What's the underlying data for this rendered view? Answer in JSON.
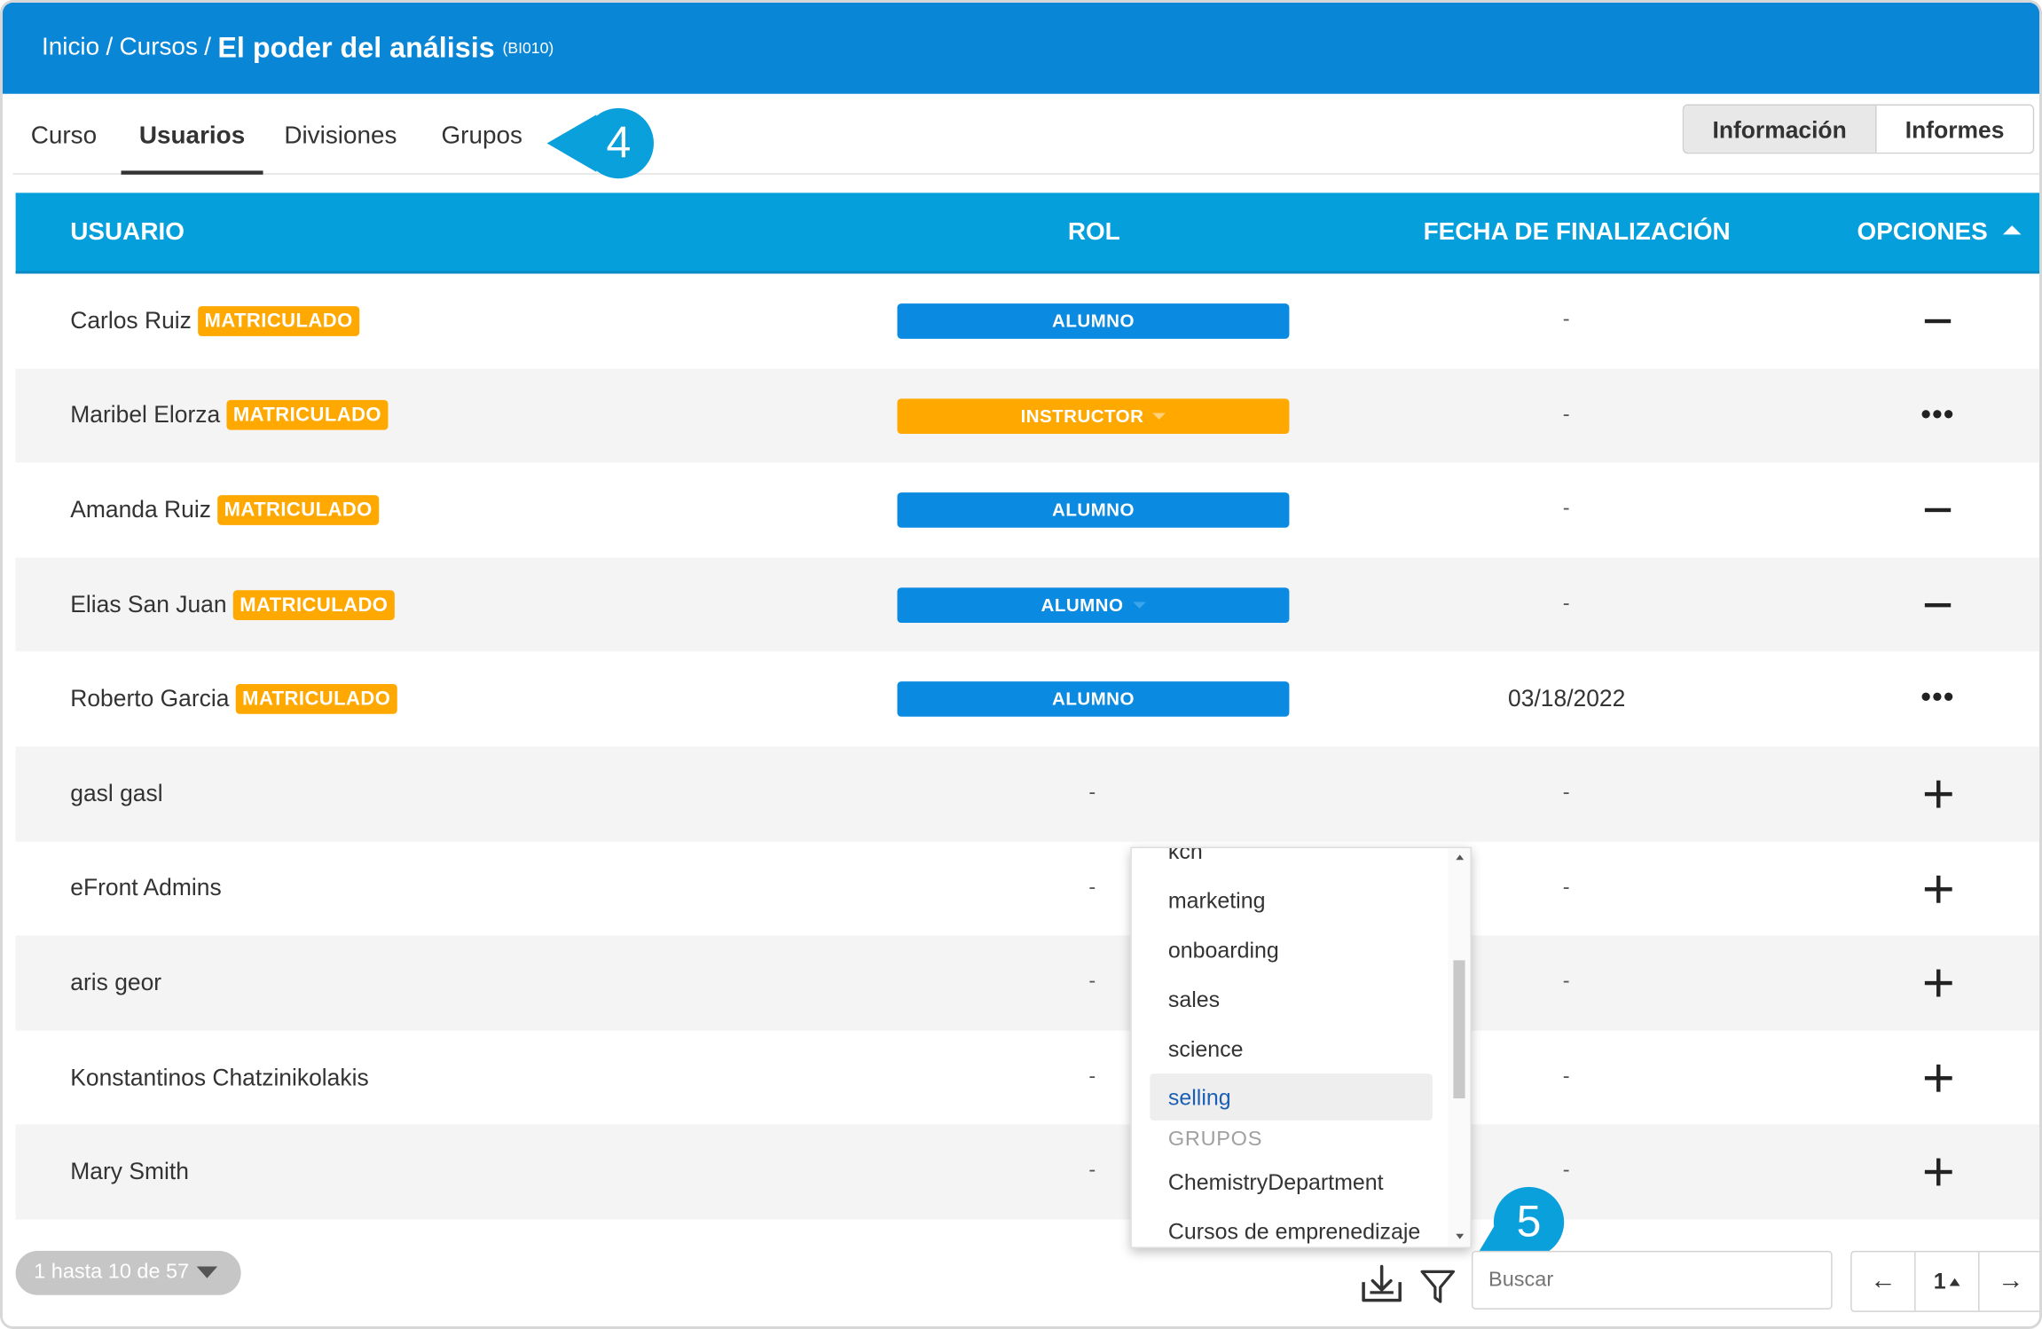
{
  "header": {
    "breadcrumb_home": "Inicio",
    "breadcrumb_sep1": "/",
    "breadcrumb_courses": "Cursos",
    "breadcrumb_sep2": "/",
    "course_title": "El poder del análisis",
    "course_code": "(BI010)"
  },
  "tabs": [
    {
      "label": "Curso"
    },
    {
      "label": "Usuarios"
    },
    {
      "label": "Divisiones"
    },
    {
      "label": "Grupos"
    }
  ],
  "markers": {
    "tab_marker": "4",
    "search_marker": "5"
  },
  "view_toggle": {
    "info": "Información",
    "reports": "Informes"
  },
  "table": {
    "columns": {
      "user": "USUARIO",
      "role": "ROL",
      "completion": "FECHA DE FINALIZACIÓN",
      "options": "OPCIONES"
    },
    "rows": [
      {
        "name": "Carlos Ruiz",
        "status": "MATRICULADO",
        "role": "ALUMNO",
        "date": "-",
        "option": "minus"
      },
      {
        "name": "Maribel Elorza",
        "status": "MATRICULADO",
        "role": "INSTRUCTOR",
        "date": "-",
        "option": "more"
      },
      {
        "name": "Amanda Ruiz",
        "status": "MATRICULADO",
        "role": "ALUMNO",
        "date": "-",
        "option": "minus"
      },
      {
        "name": "Elias San Juan",
        "status": "MATRICULADO",
        "role": "ALUMNO",
        "date": "-",
        "option": "minus"
      },
      {
        "name": "Roberto Garcia",
        "status": "MATRICULADO",
        "role": "ALUMNO",
        "date": "03/18/2022",
        "option": "more"
      },
      {
        "name": "gasl gasl",
        "status": "",
        "role": "-",
        "date": "-",
        "option": "plus"
      },
      {
        "name": "eFront Admins",
        "status": "",
        "role": "-",
        "date": "-",
        "option": "plus"
      },
      {
        "name": "aris geor",
        "status": "",
        "role": "-",
        "date": "-",
        "option": "plus"
      },
      {
        "name": "Konstantinos Chatzinikolakis",
        "status": "",
        "role": "-",
        "date": "-",
        "option": "plus"
      },
      {
        "name": "Mary Smith",
        "status": "",
        "role": "-",
        "date": "-",
        "option": "plus"
      }
    ]
  },
  "filter_dropdown": {
    "items": [
      "kcn",
      "marketing",
      "onboarding",
      "sales",
      "science",
      "selling"
    ],
    "selected": "selling",
    "group_header": "GRUPOS",
    "group_items": [
      "ChemistryDepartment",
      "Cursos de emprenedizaje"
    ]
  },
  "footer": {
    "range_label": "1 hasta 10 de 57",
    "search_placeholder": "Buscar",
    "page": "1",
    "prev": "←",
    "next": "→"
  },
  "colors": {
    "header_bg": "#0a86d6",
    "table_header_bg": "#059fdc",
    "role_blue": "#0a8ae0",
    "role_orange": "#ffa800",
    "status_orange": "#ffa800",
    "marker_blue": "#0aa0dc"
  },
  "icons": {
    "download": "download-icon",
    "filter": "filter-icon",
    "sort": "sort-asc-icon"
  }
}
